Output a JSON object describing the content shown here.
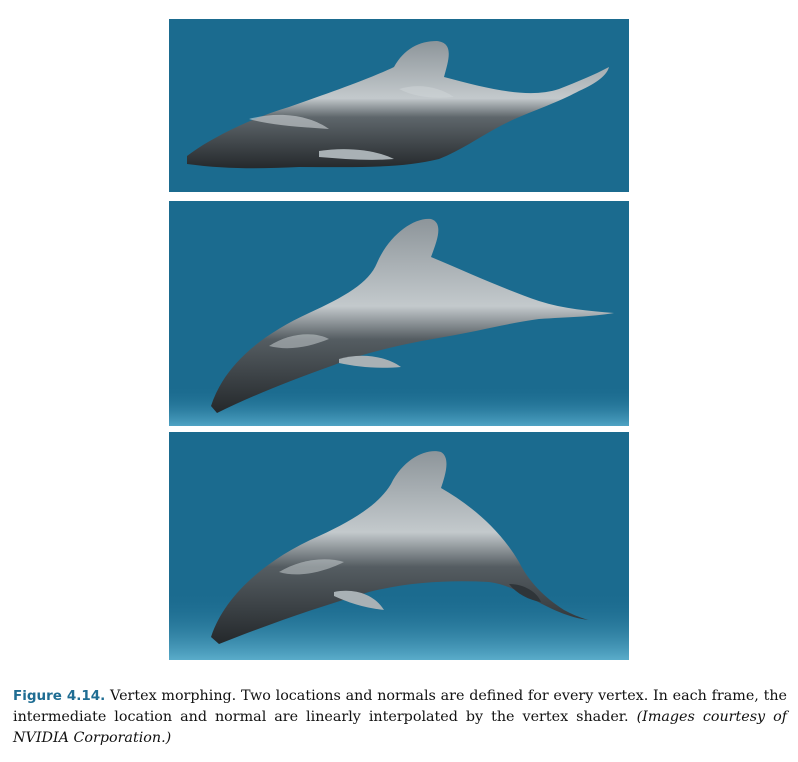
{
  "figure": {
    "label": "Figure 4.14.",
    "caption_text": " Vertex morphing. Two locations and normals are defined for every vertex. In each frame, the intermediate location and normal are linearly interpolated by the vertex shader. ",
    "credit": "(Images courtesy of NVIDIA Corporation.)"
  },
  "colors": {
    "water": "#1b6b8f",
    "water_light": "#4fa3c4",
    "dolphin_dark": "#2a2f33",
    "dolphin_light": "#b9c0c4",
    "label_blue": "#1f6d93"
  },
  "panels": [
    {
      "name": "morph-frame-1",
      "subject": "dolphin",
      "sea_floor": false
    },
    {
      "name": "morph-frame-2",
      "subject": "dolphin",
      "sea_floor": true
    },
    {
      "name": "morph-frame-3",
      "subject": "dolphin",
      "sea_floor": true
    }
  ]
}
